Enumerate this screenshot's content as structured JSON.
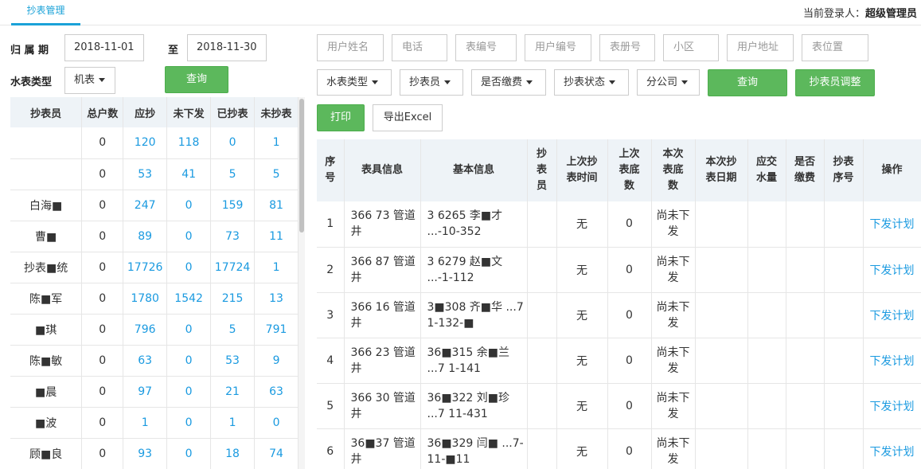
{
  "header": {
    "tab_label": "抄表管理",
    "login_prefix": "当前登录人：",
    "login_user": "超级管理员"
  },
  "filters": {
    "period_label": "归 属 期",
    "date_from": "2018-11-01",
    "to_label": "至",
    "date_to": "2018-11-30",
    "meter_type_label": "水表类型",
    "meter_type_value": "机表",
    "query_label": "查询",
    "search_fields": [
      "用户姓名",
      "电话",
      "表编号",
      "用户编号",
      "表册号",
      "小区",
      "用户地址",
      "表位置"
    ],
    "dropdowns": [
      "水表类型",
      "抄表员",
      "是否缴费",
      "抄表状态",
      "分公司"
    ],
    "query2_label": "查询",
    "adjust_label": "抄表员调整",
    "print_label": "打印",
    "export_label": "导出Excel"
  },
  "left_table": {
    "headers": [
      "抄表员",
      "总户数",
      "应抄",
      "未下发",
      "已抄表",
      "未抄表"
    ],
    "rows": [
      [
        "",
        "0",
        "120",
        "118",
        "0",
        "1"
      ],
      [
        "",
        "0",
        "53",
        "41",
        "5",
        "5"
      ],
      [
        "白海■",
        "0",
        "247",
        "0",
        "159",
        "81"
      ],
      [
        "曹■",
        "0",
        "89",
        "0",
        "73",
        "11"
      ],
      [
        "抄表■统",
        "0",
        "17726",
        "0",
        "17724",
        "1"
      ],
      [
        "陈■军",
        "0",
        "1780",
        "1542",
        "215",
        "13"
      ],
      [
        "■琪",
        "0",
        "796",
        "0",
        "5",
        "791"
      ],
      [
        "陈■敏",
        "0",
        "63",
        "0",
        "53",
        "9"
      ],
      [
        "■晨",
        "0",
        "97",
        "0",
        "21",
        "63"
      ],
      [
        "■波",
        "0",
        "1",
        "0",
        "1",
        "0"
      ],
      [
        "顾■良",
        "0",
        "93",
        "0",
        "18",
        "74"
      ]
    ]
  },
  "right_table": {
    "headers": [
      "序号",
      "表具信息",
      "基本信息",
      "抄表员",
      "上次抄表时间",
      "上次表底数",
      "本次表底数",
      "本次抄表日期",
      "应交水量",
      "是否缴费",
      "抄表序号",
      "操作"
    ],
    "rows": [
      {
        "no": "1",
        "meter": "366 73 管道井",
        "basic": "3 6265 李■才 ...-10-352",
        "reader": "",
        "last_time": "无",
        "last_base": "0",
        "cur_base": "尚未下发",
        "cur_date": "",
        "water": "",
        "paid": "",
        "seq": "",
        "action": "下发计划"
      },
      {
        "no": "2",
        "meter": "366 87 管道井",
        "basic": "3 6279 赵■文 ...-1-112",
        "reader": "",
        "last_time": "无",
        "last_base": "0",
        "cur_base": "尚未下发",
        "cur_date": "",
        "water": "",
        "paid": "",
        "seq": "",
        "action": "下发计划"
      },
      {
        "no": "3",
        "meter": "366 16 管道井",
        "basic": "3■308 齐■华 ...7 1-132-■",
        "reader": "",
        "last_time": "无",
        "last_base": "0",
        "cur_base": "尚未下发",
        "cur_date": "",
        "water": "",
        "paid": "",
        "seq": "",
        "action": "下发计划"
      },
      {
        "no": "4",
        "meter": "366 23 管道井",
        "basic": "36■315 余■兰 ...7 1-141",
        "reader": "",
        "last_time": "无",
        "last_base": "0",
        "cur_base": "尚未下发",
        "cur_date": "",
        "water": "",
        "paid": "",
        "seq": "",
        "action": "下发计划"
      },
      {
        "no": "5",
        "meter": "366 30 管道井",
        "basic": "36■322 刘■珍 ...7 11-431",
        "reader": "",
        "last_time": "无",
        "last_base": "0",
        "cur_base": "尚未下发",
        "cur_date": "",
        "water": "",
        "paid": "",
        "seq": "",
        "action": "下发计划"
      },
      {
        "no": "6",
        "meter": "36■37 管道井",
        "basic": "36■329 闫■ ...7- 11-■11",
        "reader": "",
        "last_time": "无",
        "last_base": "0",
        "cur_base": "尚未下发",
        "cur_date": "",
        "water": "",
        "paid": "",
        "seq": "",
        "action": "下发计划"
      }
    ]
  }
}
